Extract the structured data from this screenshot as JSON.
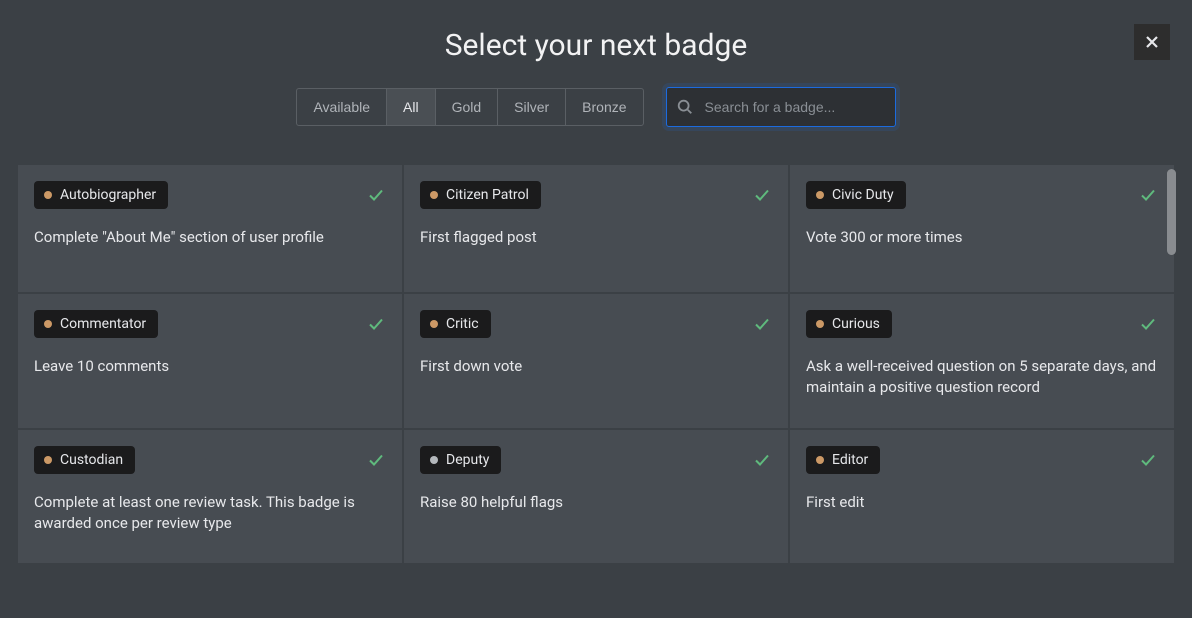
{
  "title": "Select your next badge",
  "tabs": [
    {
      "label": "Available",
      "active": false
    },
    {
      "label": "All",
      "active": true
    },
    {
      "label": "Gold",
      "active": false
    },
    {
      "label": "Silver",
      "active": false
    },
    {
      "label": "Bronze",
      "active": false
    }
  ],
  "search": {
    "placeholder": "Search for a badge...",
    "value": ""
  },
  "badges": [
    {
      "name": "Autobiographer",
      "desc": "Complete \"About Me\" section of user profile",
      "tier": "bronze",
      "earned": true
    },
    {
      "name": "Citizen Patrol",
      "desc": "First flagged post",
      "tier": "bronze",
      "earned": true
    },
    {
      "name": "Civic Duty",
      "desc": "Vote 300 or more times",
      "tier": "bronze",
      "earned": true
    },
    {
      "name": "Commentator",
      "desc": "Leave 10 comments",
      "tier": "bronze",
      "earned": true
    },
    {
      "name": "Critic",
      "desc": "First down vote",
      "tier": "bronze",
      "earned": true
    },
    {
      "name": "Curious",
      "desc": "Ask a well-received question on 5 separate days, and maintain a positive question record",
      "tier": "bronze",
      "earned": true
    },
    {
      "name": "Custodian",
      "desc": "Complete at least one review task. This badge is awarded once per review type",
      "tier": "bronze",
      "earned": true
    },
    {
      "name": "Deputy",
      "desc": "Raise 80 helpful flags",
      "tier": "silver",
      "earned": true
    },
    {
      "name": "Editor",
      "desc": "First edit",
      "tier": "bronze",
      "earned": true
    }
  ]
}
